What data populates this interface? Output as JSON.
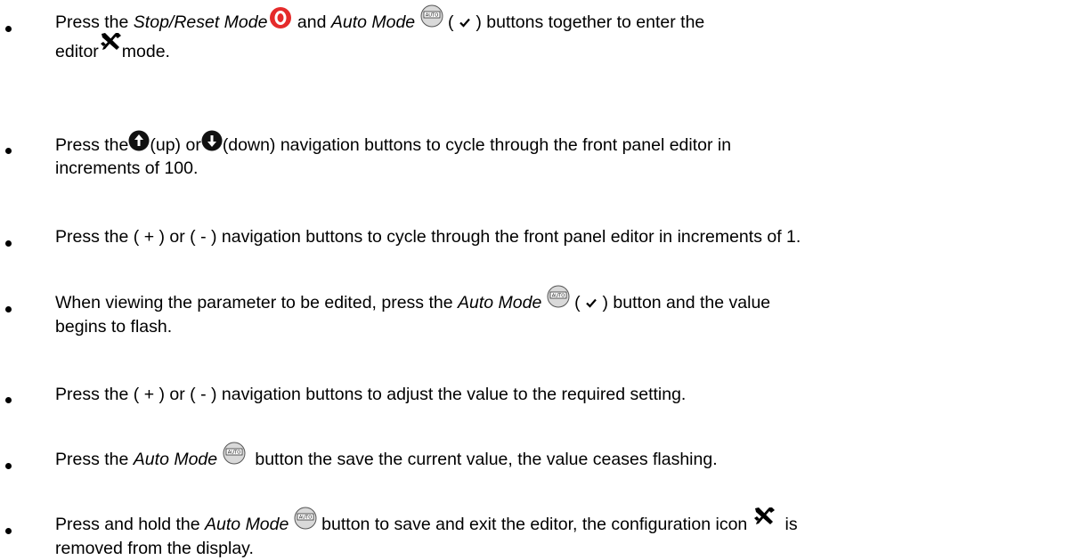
{
  "page": {
    "instructions": [
      {
        "parts": [
          {
            "t": "Press the "
          },
          {
            "t": "Stop/Reset Mode",
            "italic": true
          },
          {
            "icon": "stop-reset-icon"
          },
          {
            "t": " and "
          },
          {
            "t": "Auto Mode",
            "italic": true
          },
          {
            "t": " "
          },
          {
            "icon": "auto-mode-icon"
          },
          {
            "t": " ( "
          },
          {
            "icon": "check-icon"
          },
          {
            "t": " ) buttons together to enter the"
          },
          {
            "br": true
          },
          {
            "t": "editor"
          },
          {
            "icon": "tools-icon"
          },
          {
            "t": "mode."
          }
        ]
      },
      {
        "parts": [
          {
            "t": "Press the"
          },
          {
            "icon": "up-arrow-icon"
          },
          {
            "t": "(up) or"
          },
          {
            "icon": "down-arrow-icon"
          },
          {
            "t": "(down) navigation buttons to cycle through the front panel editor in"
          },
          {
            "br": true
          },
          {
            "t": "increments of 100."
          }
        ]
      },
      {
        "parts": [
          {
            "t": "Press the ( + ) or ( - ) navigation buttons to cycle through the front panel editor in increments of 1."
          }
        ]
      },
      {
        "parts": [
          {
            "t": "When viewing the parameter to be edited, press the "
          },
          {
            "t": "Auto Mode",
            "italic": true
          },
          {
            "t": " "
          },
          {
            "icon": "auto-mode-icon"
          },
          {
            "t": " ( "
          },
          {
            "icon": "check-icon"
          },
          {
            "t": " ) button and the value"
          },
          {
            "br": true
          },
          {
            "t": "begins to flash."
          }
        ]
      },
      {
        "parts": [
          {
            "t": "Press the ( + ) or ( - ) navigation buttons to adjust the value to the required setting."
          }
        ]
      },
      {
        "parts": [
          {
            "t": "Press the "
          },
          {
            "t": "Auto Mode",
            "italic": true
          },
          {
            "t": " "
          },
          {
            "icon": "auto-mode-icon"
          },
          {
            "t": "  button the save the current value, the value ceases flashing."
          }
        ]
      },
      {
        "parts": [
          {
            "t": "Press and hold the "
          },
          {
            "t": "Auto Mode",
            "italic": true
          },
          {
            "t": " "
          },
          {
            "icon": "auto-mode-icon"
          },
          {
            "t": " button to save and exit the editor, the configuration icon "
          },
          {
            "icon": "tools-icon"
          },
          {
            "t": "  is"
          },
          {
            "br": true
          },
          {
            "t": "removed from the display."
          }
        ]
      }
    ],
    "auto_icon_label": "AUTO",
    "colors": {
      "stop_red": "#e52b2b",
      "icon_dark": "#111111",
      "auto_grey": "#d9d9d9"
    }
  }
}
